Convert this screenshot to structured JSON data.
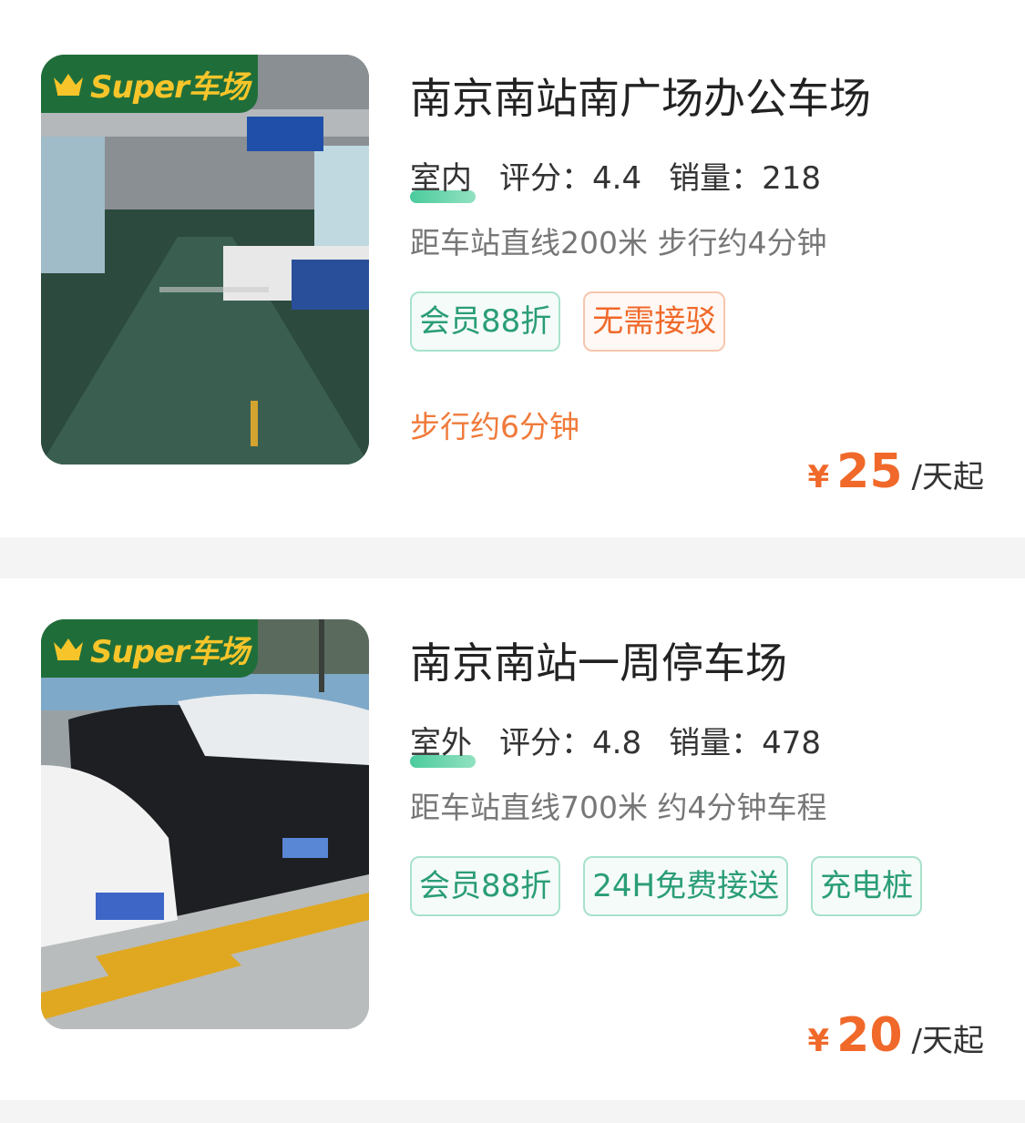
{
  "badge": {
    "text": "Super车场",
    "icon": "crown-icon"
  },
  "currency": "¥",
  "lots": [
    {
      "name": "南京南站南广场办公车场",
      "type": "室内",
      "score": "评分：4.4",
      "sales": "销量：218",
      "distance": "距车站直线200米 步行约4分钟",
      "tags": [
        {
          "text": "会员88折",
          "style": "green"
        },
        {
          "text": "无需接驳",
          "style": "orange"
        }
      ],
      "walk": "步行约6分钟",
      "price": "25",
      "unit": "/天起"
    },
    {
      "name": "南京南站一周停车场",
      "type": "室外",
      "score": "评分：4.8",
      "sales": "销量：478",
      "distance": "距车站直线700米 约4分钟车程",
      "tags": [
        {
          "text": "会员88折",
          "style": "green"
        },
        {
          "text": "24H免费接送",
          "style": "green"
        },
        {
          "text": "充电桩",
          "style": "green"
        }
      ],
      "price": "20",
      "unit": "/天起"
    }
  ],
  "colors": {
    "accent": "#f0692a",
    "green": "#2a9d78",
    "badge_bg": "#1f6e3a",
    "badge_text": "#f7c52a"
  }
}
